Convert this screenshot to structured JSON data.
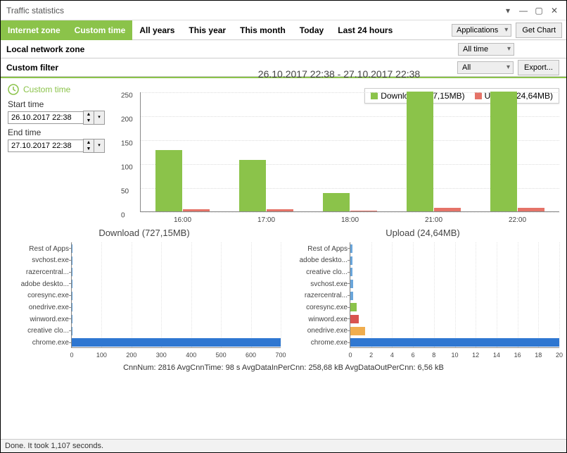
{
  "window": {
    "title": "Traffic statistics"
  },
  "tabs": {
    "internet_zone": "Internet zone",
    "custom_time": "Custom time",
    "all_years": "All years",
    "this_year": "This year",
    "this_month": "This month",
    "today": "Today",
    "last_24h": "Last 24 hours",
    "local_zone": "Local network zone",
    "custom_filter": "Custom filter"
  },
  "controls": {
    "applications": "Applications",
    "get_chart": "Get Chart",
    "all_time": "All time",
    "all": "All",
    "export": "Export..."
  },
  "custom_time": {
    "header": "Custom time",
    "start_label": "Start time",
    "start_value": "26.10.2017 22:38",
    "end_label": "End time",
    "end_value": "27.10.2017 22:38"
  },
  "main_chart_title": "26.10.2017 22:38 - 27.10.2017 22:38",
  "legend": {
    "download": "Download (727,15MB)",
    "upload": "Upload (24,64MB)"
  },
  "download_title": "Download (727,15MB)",
  "upload_title": "Upload (24,64MB)",
  "stats": "CnnNum: 2816    AvgCnnTime: 98 s    AvgDataInPerCnn: 258,68 kB    AvgDataOutPerCnn: 6,56 kB",
  "status": "Done. It took 1,107 seconds.",
  "chart_data": [
    {
      "type": "bar",
      "title": "26.10.2017 22:38 - 27.10.2017 22:38",
      "categories": [
        "16:00",
        "17:00",
        "18:00",
        "21:00",
        "22:00"
      ],
      "series": [
        {
          "name": "Download (727,15MB)",
          "values": [
            128,
            108,
            38,
            250,
            250
          ],
          "color": "#8bc34a"
        },
        {
          "name": "Upload (24,64MB)",
          "values": [
            5,
            4,
            2,
            8,
            7
          ],
          "color": "#e57368"
        }
      ],
      "ylim": [
        0,
        250
      ],
      "yticks": [
        0,
        50,
        100,
        150,
        200,
        250
      ],
      "xlabel": "",
      "ylabel": ""
    },
    {
      "type": "bar",
      "orientation": "horizontal",
      "title": "Download (727,15MB)",
      "categories": [
        "Rest of Apps",
        "svchost.exe",
        "razercentral...",
        "adobe deskto...",
        "coresync.exe",
        "onedrive.exe",
        "winword.exe",
        "creative clo...",
        "chrome.exe"
      ],
      "values": [
        1,
        1,
        1,
        1,
        1,
        1,
        1,
        1,
        700
      ],
      "xlim": [
        0,
        700
      ],
      "xticks": [
        0,
        100,
        200,
        300,
        400,
        500,
        600,
        700
      ],
      "colors": [
        "#5b9bd5",
        "#5b9bd5",
        "#5b9bd5",
        "#5b9bd5",
        "#5b9bd5",
        "#5b9bd5",
        "#5b9bd5",
        "#5b9bd5",
        "#2f77d1"
      ]
    },
    {
      "type": "bar",
      "orientation": "horizontal",
      "title": "Upload (24,64MB)",
      "categories": [
        "Rest of Apps",
        "adobe deskto...",
        "creative clo...",
        "svchost.exe",
        "razercentral...",
        "coresync.exe",
        "winword.exe",
        "onedrive.exe",
        "chrome.exe"
      ],
      "values": [
        0.2,
        0.2,
        0.2,
        0.3,
        0.3,
        0.6,
        0.8,
        1.4,
        20
      ],
      "xlim": [
        0,
        20
      ],
      "xticks": [
        0,
        2,
        4,
        6,
        8,
        10,
        12,
        14,
        16,
        18,
        20
      ],
      "colors": [
        "#6aa6db",
        "#6aa6db",
        "#6aa6db",
        "#6aa6db",
        "#6aa6db",
        "#8bc34a",
        "#d9534f",
        "#f0ad4e",
        "#2f77d1"
      ]
    }
  ]
}
